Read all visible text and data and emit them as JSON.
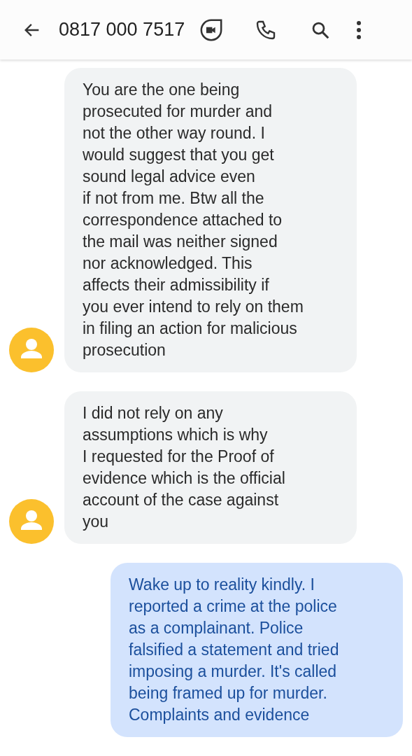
{
  "header": {
    "title": "0817 000 7517"
  },
  "messages": [
    {
      "kind": "incoming",
      "text": "You are the one being\nprosecuted for murder and\nnot the other way round. I\nwould suggest that you get\nsound legal advice even\nif not from me. Btw all the\ncorrespondence attached to\nthe mail was neither signed\nnor acknowledged. This\naffects their admissibility if\nyou ever intend to rely on them\nin filing an action for malicious\nprosecution"
    },
    {
      "kind": "incoming",
      "text": "I did not rely on any\nassumptions which is why\nI requested for the Proof of\nevidence which is the official\naccount of the case against\nyou"
    },
    {
      "kind": "outgoing",
      "text": "Wake up to reality kindly. I\nreported a crime at the police\nas a complainant. Police\nfalsified a statement and tried\nimposing a murder. It's called\nbeing framed up for murder.\nComplaints and evidence"
    }
  ]
}
